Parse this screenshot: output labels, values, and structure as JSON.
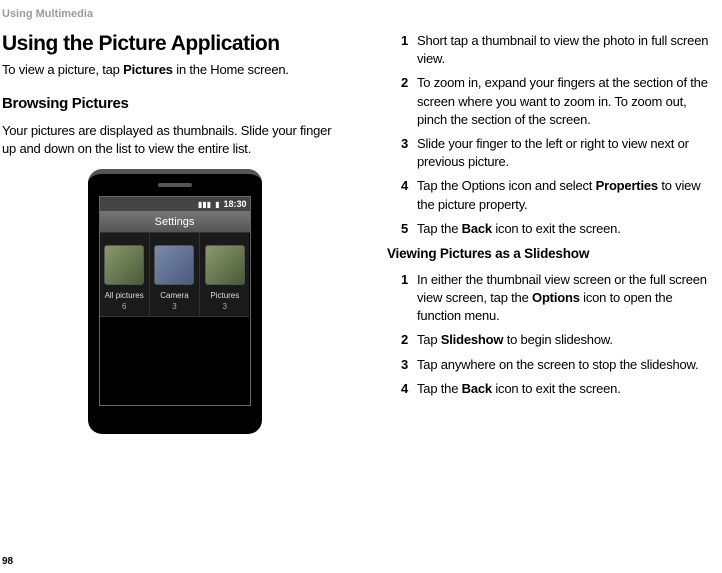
{
  "section_header": "Using Multimedia",
  "page_number": "98",
  "left": {
    "h1": "Using the Picture Application",
    "intro_pre": "To view a picture, tap ",
    "intro_bold": "Pictures",
    "intro_post": " in the Home screen.",
    "h2": "Browsing Pictures",
    "body": "Your pictures are displayed as thumbnails. Slide your finger up and down on the list to view the entire list."
  },
  "phone": {
    "time": "18:30",
    "title": "Settings",
    "tabs": [
      {
        "label": "All pictures",
        "count": "6"
      },
      {
        "label": "Camera",
        "count": "3"
      },
      {
        "label": "Pictures",
        "count": "3"
      }
    ]
  },
  "right": {
    "steps_a": [
      {
        "num": "1",
        "text": "Short tap a thumbnail to view the photo in full screen view."
      },
      {
        "num": "2",
        "text": "To zoom in, expand your fingers at the section of the screen where you want to zoom in. To zoom out, pinch the section of the screen."
      },
      {
        "num": "3",
        "text": "Slide your finger to the left or right to view next or previous picture."
      },
      {
        "num": "4",
        "pre": "Tap the Options icon and select ",
        "bold": "Properties",
        "post": " to view the picture property."
      },
      {
        "num": "5",
        "pre": "Tap the ",
        "bold": "Back",
        "post": " icon to exit the screen."
      }
    ],
    "h3": "Viewing Pictures as a Slideshow",
    "steps_b": [
      {
        "num": "1",
        "pre": "In either the thumbnail view screen or the full screen view screen, tap the ",
        "bold": "Options",
        "post": " icon to open the function menu."
      },
      {
        "num": "2",
        "pre": "Tap ",
        "bold": "Slideshow",
        "post": " to begin slideshow."
      },
      {
        "num": "3",
        "text": "Tap anywhere on the screen to stop the slideshow."
      },
      {
        "num": "4",
        "pre": "Tap the ",
        "bold": "Back",
        "post": " icon to exit the screen."
      }
    ]
  }
}
